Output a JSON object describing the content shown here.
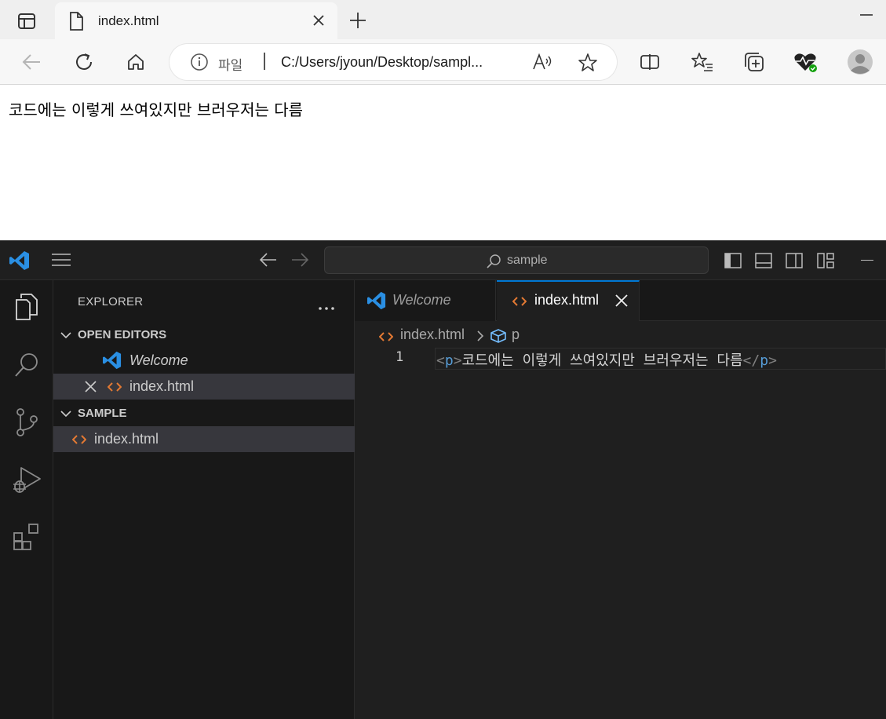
{
  "browser": {
    "tab": {
      "title": "index.html"
    },
    "address": {
      "scheme_label": "파일",
      "url": "C:/Users/jyoun/Desktop/sampl..."
    },
    "page": {
      "text": "코드에는 이렇게 쓰여있지만 브러우저는 다름"
    }
  },
  "vscode": {
    "search": {
      "text": "sample"
    },
    "explorer": {
      "title": "EXPLORER",
      "open_editors_label": "OPEN EDITORS",
      "open_editors": [
        "Welcome",
        "index.html"
      ],
      "folder_label": "SAMPLE",
      "files": [
        "index.html"
      ]
    },
    "tabs": {
      "welcome": "Welcome",
      "active": "index.html"
    },
    "breadcrumb": {
      "file": "index.html",
      "symbol": "p"
    },
    "code": {
      "line_number": "1",
      "open_tag_lt": "<",
      "tag": "p",
      "open_tag_gt": ">",
      "text": "코드에는 이렇게 쓰여있지만 브러우저는 다름",
      "close_tag_lt": "</",
      "close_tag_gt": ">"
    }
  },
  "colors": {
    "vscode_accent": "#0078d4",
    "html_icon": "#e37933",
    "vscode_logo": "#2a8fe3",
    "tag_color": "#569cd6"
  }
}
